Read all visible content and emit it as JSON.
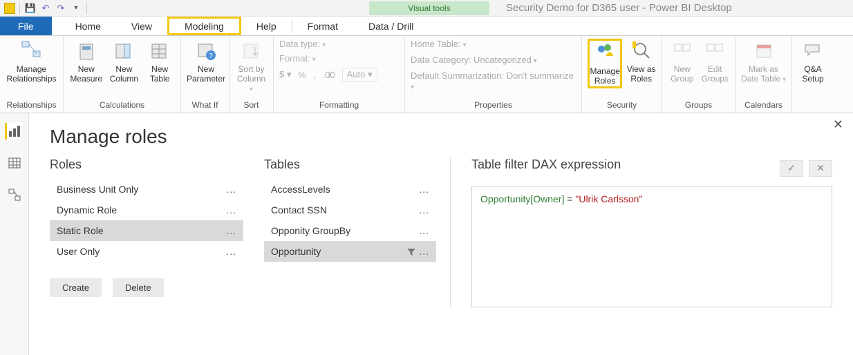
{
  "title": {
    "context_tab": "Visual tools",
    "app_title": "Security Demo for D365 user - Power BI Desktop"
  },
  "tabs": {
    "file": "File",
    "home": "Home",
    "view": "View",
    "modeling": "Modeling",
    "help": "Help",
    "format": "Format",
    "data_drill": "Data / Drill"
  },
  "ribbon": {
    "relationships": {
      "manage": "Manage\nRelationships",
      "group": "Relationships"
    },
    "calculations": {
      "new_measure": "New\nMeasure",
      "new_column": "New\nColumn",
      "new_table": "New\nTable",
      "group": "Calculations"
    },
    "whatif": {
      "new_parameter": "New\nParameter",
      "group": "What If"
    },
    "sort": {
      "sort_by_column": "Sort by\nColumn",
      "group": "Sort"
    },
    "formatting": {
      "data_type": "Data type:",
      "format": "Format:",
      "currency": "$ ▾",
      "percent": "%",
      "comma": ",",
      "decimals": ".0",
      "auto": "Auto",
      "group": "Formatting"
    },
    "properties": {
      "home_table": "Home Table:",
      "data_category": "Data Category: Uncategorized",
      "default_summarization": "Default Summarization: Don't summarize",
      "group": "Properties"
    },
    "security": {
      "manage_roles": "Manage\nRoles",
      "view_as_roles": "View as\nRoles",
      "group": "Security"
    },
    "groups": {
      "new_group": "New\nGroup",
      "edit_groups": "Edit\nGroups",
      "group": "Groups"
    },
    "calendars": {
      "mark_as_date": "Mark as\nDate Table",
      "group": "Calendars"
    },
    "qa": {
      "qa_setup": "Q&A\nSetup"
    }
  },
  "dialog": {
    "title": "Manage roles",
    "roles_header": "Roles",
    "tables_header": "Tables",
    "expr_header": "Table filter DAX expression",
    "roles": [
      "Business Unit Only",
      "Dynamic Role",
      "Static Role",
      "User Only"
    ],
    "roles_selected_index": 2,
    "tables": [
      "AccessLevels",
      "Contact SSN",
      "Opponity GroupBy",
      "Opportunity"
    ],
    "tables_selected_index": 3,
    "tables_filtered_index": 3,
    "create": "Create",
    "delete": "Delete",
    "expression": {
      "field": "Opportunity[Owner]",
      "op": " = ",
      "value": "\"Ulrik Carlsson\""
    }
  }
}
